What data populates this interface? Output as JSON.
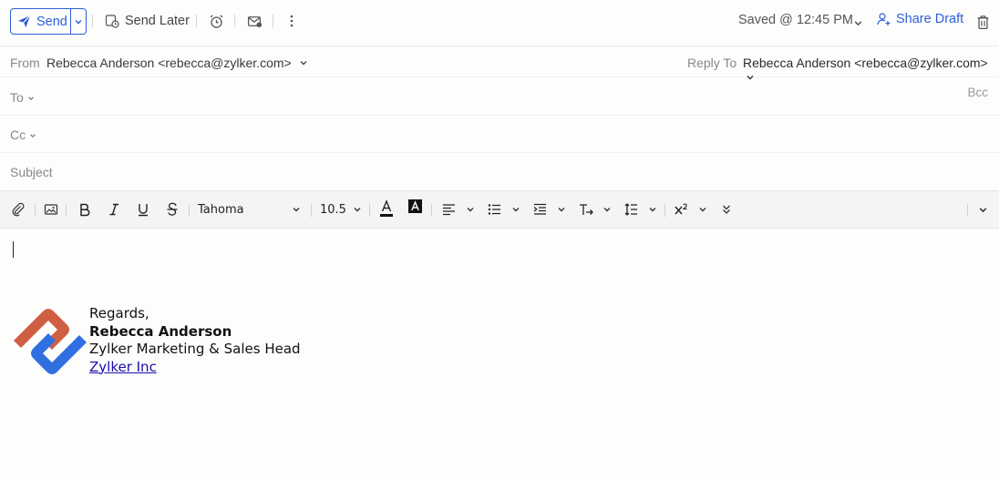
{
  "toolbar": {
    "send_label": "Send",
    "send_later_label": "Send Later",
    "saved_status": "Saved @ 12:45 PM",
    "share_draft_label": "Share Draft"
  },
  "header": {
    "from_label": "From",
    "from_value": "Rebecca Anderson <rebecca@zylker.com>",
    "reply_to_label": "Reply To",
    "reply_to_value": "Rebecca Anderson <rebecca@zylker.com>",
    "to_label": "To",
    "cc_label": "Cc",
    "bcc_label": "Bcc",
    "subject_placeholder": "Subject"
  },
  "format": {
    "font_family": "Tahoma",
    "font_size": "10.5"
  },
  "signature": {
    "greeting": "Regards,",
    "name": "Rebecca Anderson",
    "title": "Zylker Marketing & Sales Head",
    "company_link": "Zylker Inc"
  },
  "colors": {
    "accent": "#2c5fd8",
    "logo_orange": "#cf5f43",
    "logo_blue": "#2f6fe0"
  }
}
